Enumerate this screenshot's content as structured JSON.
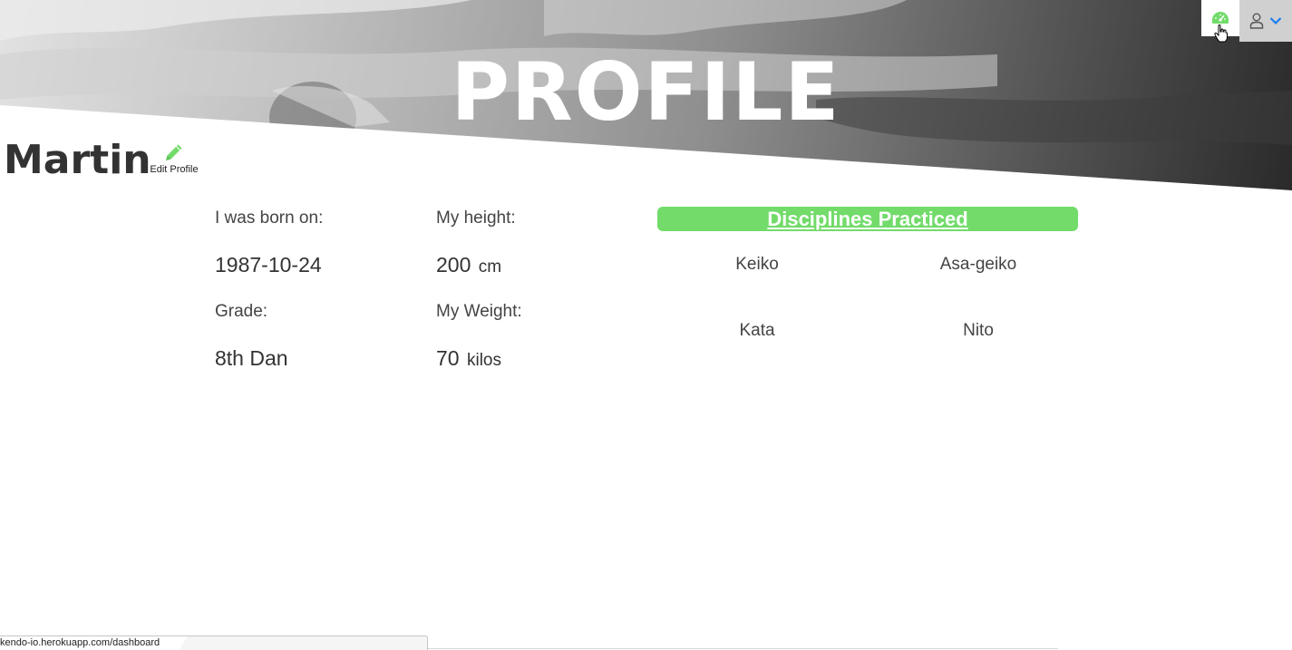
{
  "header": {
    "title": "PROFILE"
  },
  "nav": {
    "dashboard_icon": "speedometer-icon",
    "user_icon": "user-icon",
    "dropdown_icon": "chevron-down-icon"
  },
  "profile": {
    "name": "Martin",
    "edit_label": "Edit Profile",
    "edit_icon": "pencil-icon"
  },
  "info": {
    "born_label": "I was born on:",
    "born_value": "1987-10-24",
    "height_label": "My height:",
    "height_value": "200",
    "height_unit": "cm",
    "grade_label": "Grade:",
    "grade_value": "8th Dan",
    "weight_label": "My Weight:",
    "weight_value": "70",
    "weight_unit": "kilos"
  },
  "disciplines": {
    "title": "Disciplines Practiced",
    "items": [
      "Keiko",
      "Asa-geiko",
      "Kata",
      "Nito"
    ]
  },
  "status_bar": {
    "url": "kendo-io.herokuapp.com/dashboard"
  },
  "colors": {
    "accent": "#72db6a",
    "nav_active": "#1a7ef0"
  }
}
